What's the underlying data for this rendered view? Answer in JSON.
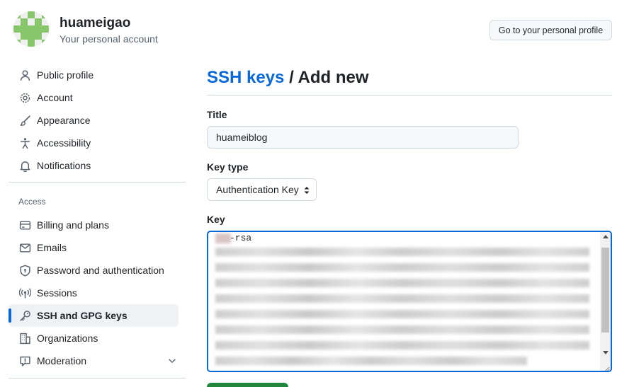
{
  "user": {
    "name": "huameigao",
    "subtitle": "Your personal account",
    "avatar_colors": [
      "#87c66a",
      "#ffffff"
    ]
  },
  "header": {
    "profile_button": "Go to your personal profile"
  },
  "sidebar": {
    "items": [
      {
        "label": "Public profile",
        "icon": "person-icon"
      },
      {
        "label": "Account",
        "icon": "gear-icon"
      },
      {
        "label": "Appearance",
        "icon": "paintbrush-icon"
      },
      {
        "label": "Accessibility",
        "icon": "accessibility-icon"
      },
      {
        "label": "Notifications",
        "icon": "bell-icon"
      }
    ],
    "access_heading": "Access",
    "access_items": [
      {
        "label": "Billing and plans",
        "icon": "credit-card-icon"
      },
      {
        "label": "Emails",
        "icon": "mail-icon"
      },
      {
        "label": "Password and authentication",
        "icon": "shield-lock-icon"
      },
      {
        "label": "Sessions",
        "icon": "broadcast-icon"
      },
      {
        "label": "SSH and GPG keys",
        "icon": "key-icon",
        "active": true
      },
      {
        "label": "Organizations",
        "icon": "organization-icon"
      },
      {
        "label": "Moderation",
        "icon": "report-icon",
        "expandable": true
      }
    ]
  },
  "main": {
    "breadcrumb_link": "SSH keys",
    "breadcrumb_sep": " / ",
    "breadcrumb_current": "Add new",
    "title_label": "Title",
    "title_value": "huameiblog",
    "key_type_label": "Key type",
    "key_type_value": "Authentication Key",
    "key_label": "Key",
    "key_value_visible": "-rsa"
  },
  "colors": {
    "accent": "#0969da",
    "success": "#1f883d"
  }
}
